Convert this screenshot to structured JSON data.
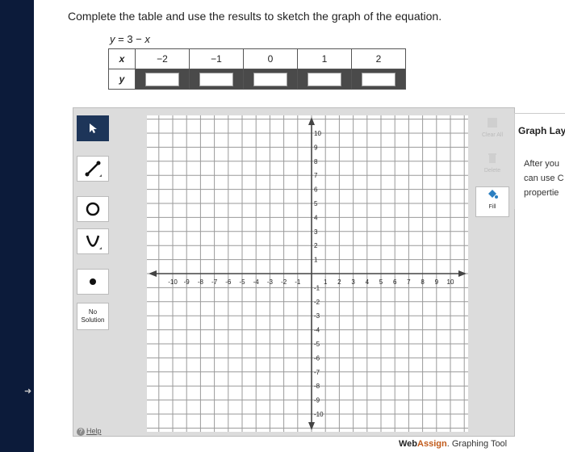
{
  "instruction": "Complete the table and use the results to sketch the graph of the equation.",
  "equation": {
    "y": "y",
    "eq": " = 3 − ",
    "x": "x"
  },
  "table": {
    "x_header": "x",
    "y_header": "y",
    "x_values": [
      "−2",
      "−1",
      "0",
      "1",
      "2"
    ]
  },
  "tools": {
    "no_solution_line1": "No",
    "no_solution_line2": "Solution",
    "help": "Help"
  },
  "side_tools": {
    "clear_all": "Clear All",
    "delete": "Delete",
    "fill": "Fill"
  },
  "graph_layers": {
    "title": "Graph Lay",
    "body": [
      "After you",
      "can use C",
      "propertie"
    ]
  },
  "axis": {
    "x_ticks": [
      "-10",
      "-9",
      "-8",
      "-7",
      "-6",
      "-5",
      "-4",
      "-3",
      "-2",
      "-1",
      "1",
      "2",
      "3",
      "4",
      "5",
      "6",
      "7",
      "8",
      "9",
      "10"
    ],
    "y_ticks": [
      "10",
      "9",
      "8",
      "7",
      "6",
      "5",
      "4",
      "3",
      "2",
      "1",
      "-1",
      "-2",
      "-3",
      "-4",
      "-5",
      "-6",
      "-7",
      "-8",
      "-9",
      "-10"
    ]
  },
  "footer": {
    "brand_a": "Web",
    "brand_b": "Assign",
    "brand_c": ". Graphing Tool"
  }
}
